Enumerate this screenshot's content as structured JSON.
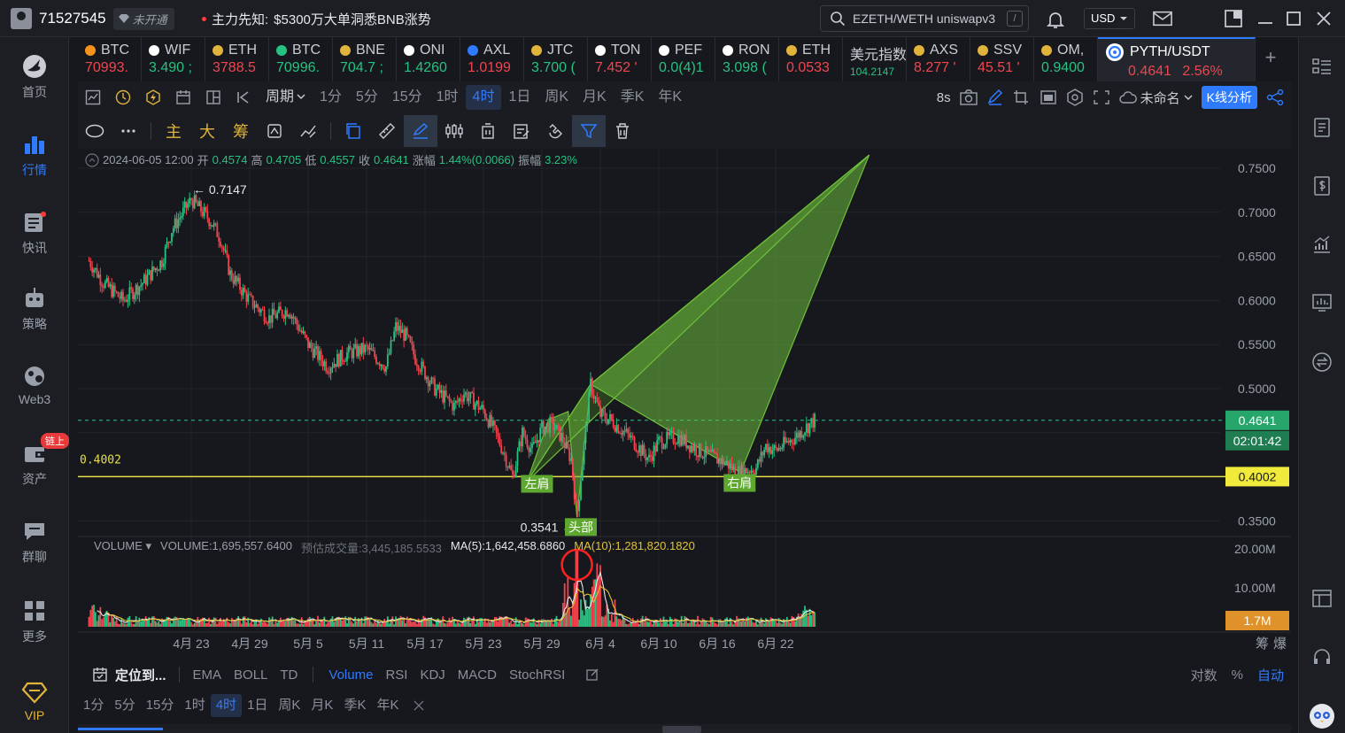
{
  "topbar": {
    "user_id": "71527545",
    "vip_status": "未开通",
    "news_label": "主力先知:",
    "news_text": "$5300万大单洞悉BNB涨势",
    "search_value": "EZETH/WETH uniswapv3",
    "search_shortcut": "/",
    "currency": "USD"
  },
  "leftnav": [
    {
      "label": "首页",
      "icon": "home-icon"
    },
    {
      "label": "行情",
      "icon": "bar-chart-icon"
    },
    {
      "label": "快讯",
      "icon": "news-icon"
    },
    {
      "label": "策略",
      "icon": "robot-icon"
    },
    {
      "label": "Web3",
      "icon": "web3-icon"
    },
    {
      "label": "资产",
      "icon": "wallet-icon",
      "badge": "链上"
    },
    {
      "label": "群聊",
      "icon": "chat-icon"
    },
    {
      "label": "更多",
      "icon": "grid-icon"
    },
    {
      "label": "VIP",
      "icon": "diamond-icon"
    }
  ],
  "tickers": [
    {
      "name": "BTC",
      "price": "70993.",
      "color": "#f7931a",
      "dir": "down"
    },
    {
      "name": "WIF",
      "price": "3.490 ;",
      "color": "#ffffff",
      "dir": "up"
    },
    {
      "name": "ETH",
      "price": "3788.5",
      "color": "#e0b33a",
      "dir": "down"
    },
    {
      "name": "BTC",
      "price": "70996.",
      "color": "#26c281",
      "dir": "up"
    },
    {
      "name": "BNE",
      "price": "704.7 ;",
      "color": "#e0b33a",
      "dir": "up"
    },
    {
      "name": "ONI",
      "price": "1.4260",
      "color": "#ffffff",
      "dir": "up"
    },
    {
      "name": "AXL",
      "price": "1.0199",
      "color": "#2f7bff",
      "dir": "down"
    },
    {
      "name": "JTC",
      "price": "3.700 (",
      "color": "#e0b33a",
      "dir": "up"
    },
    {
      "name": "TON",
      "price": "7.452 '",
      "color": "#ffffff",
      "dir": "down"
    },
    {
      "name": "PEF",
      "price": "0.0(4)1",
      "color": "#ffffff",
      "dir": "up"
    },
    {
      "name": "RON",
      "price": "3.098 (",
      "color": "#ffffff",
      "dir": "up"
    },
    {
      "name": "ETH",
      "price": "0.0533",
      "color": "#e0b33a",
      "dir": "down"
    },
    {
      "name": "美元指数",
      "price": "104.2147",
      "color": "",
      "dir": "up"
    },
    {
      "name": "AXS",
      "price": "8.277 '",
      "color": "#e0b33a",
      "dir": "down"
    },
    {
      "name": "SSV",
      "price": "45.51 '",
      "color": "#e0b33a",
      "dir": "down"
    },
    {
      "name": "OM,",
      "price": "0.9400",
      "color": "#e0b33a",
      "dir": "up"
    }
  ],
  "active_ticker": {
    "name": "PYTH/USDT",
    "price": "0.4641",
    "change": "2.56%"
  },
  "intervals": [
    "周期",
    "1分",
    "5分",
    "15分",
    "1时",
    "4时",
    "1日",
    "周K",
    "月K",
    "季K",
    "年K"
  ],
  "active_interval": "4时",
  "toolbar_right": {
    "refresh": "8s",
    "layout_name": "未命名",
    "analysis_button": "K线分析"
  },
  "drawbar": [
    "主",
    "大",
    "筹"
  ],
  "ohlc": {
    "date": "2024-06-05 12:00",
    "open_label": "开",
    "open": "0.4574",
    "high_label": "高",
    "high": "0.4705",
    "low_label": "低",
    "low": "0.4557",
    "close_label": "收",
    "close": "0.4641",
    "change_label": "涨幅",
    "change": "1.44%(0.0066)",
    "amplitude_label": "振幅",
    "amplitude": "3.23%"
  },
  "chart_data": {
    "type": "candlestick",
    "y_axis": [
      "0.7500",
      "0.7000",
      "0.6500",
      "0.6000",
      "0.5500",
      "0.5000",
      "0.3500"
    ],
    "ylim": [
      0.335,
      0.765
    ],
    "x_axis": [
      "4月 23",
      "4月 29",
      "5月 5",
      "5月 11",
      "5月 17",
      "5月 23",
      "5月 29",
      "6月 4",
      "6月 10",
      "6月 16",
      "6月 22"
    ],
    "x_range_days": [
      0,
      63
    ],
    "price_path": [
      [
        -0.5,
        0.645
      ],
      [
        1,
        0.62
      ],
      [
        3,
        0.6
      ],
      [
        5,
        0.62
      ],
      [
        7,
        0.645
      ],
      [
        8,
        0.68
      ],
      [
        10,
        0.7147
      ],
      [
        12,
        0.69
      ],
      [
        13,
        0.67
      ],
      [
        14,
        0.63
      ],
      [
        16,
        0.6
      ],
      [
        18,
        0.58
      ],
      [
        20,
        0.59
      ],
      [
        21,
        0.57
      ],
      [
        22,
        0.55
      ],
      [
        24,
        0.525
      ],
      [
        26,
        0.54
      ],
      [
        28,
        0.545
      ],
      [
        30,
        0.525
      ],
      [
        31,
        0.57
      ],
      [
        32,
        0.56
      ],
      [
        33,
        0.535
      ],
      [
        35,
        0.5
      ],
      [
        37,
        0.48
      ],
      [
        38,
        0.495
      ],
      [
        40,
        0.475
      ],
      [
        41,
        0.455
      ],
      [
        42,
        0.43
      ],
      [
        43,
        0.4
      ],
      [
        44,
        0.45
      ],
      [
        45,
        0.43
      ],
      [
        46,
        0.455
      ],
      [
        47,
        0.46
      ],
      [
        48,
        0.445
      ],
      [
        49,
        0.42
      ],
      [
        49.6,
        0.3541
      ],
      [
        50,
        0.4
      ],
      [
        51,
        0.505
      ],
      [
        52,
        0.47
      ],
      [
        53,
        0.465
      ],
      [
        55,
        0.445
      ],
      [
        57,
        0.42
      ],
      [
        58,
        0.44
      ],
      [
        60,
        0.445
      ],
      [
        62,
        0.43
      ],
      [
        63,
        0.425
      ],
      [
        65,
        0.415
      ],
      [
        66,
        0.405
      ],
      [
        68,
        0.41
      ],
      [
        69,
        0.435
      ],
      [
        70,
        0.43
      ],
      [
        72,
        0.445
      ],
      [
        73,
        0.455
      ],
      [
        74,
        0.4641
      ]
    ],
    "high_label": "← 0.7147",
    "low_label": "0.3541 →",
    "support_line": {
      "value": 0.4002,
      "label": "0.4002"
    },
    "current_price": "0.4641",
    "countdown": "02:01:42",
    "pattern_labels": [
      "左肩",
      "头部",
      "右肩"
    ],
    "volume": {
      "label": "VOLUME",
      "value_label": "VOLUME:1,695,557.6400",
      "estimate_label": "预估成交量:3,445,185.5533",
      "ma5_label": "MA(5):1,642,458.6860",
      "ma10_label": "MA(10):1,281,820.1820",
      "y_axis": [
        "20.00M",
        "10.00M"
      ],
      "current": "1.7M"
    }
  },
  "indicators": [
    "EMA",
    "BOLL",
    "TD",
    "Volume",
    "RSI",
    "KDJ",
    "MACD",
    "StochRSI"
  ],
  "active_indicator": "Volume",
  "locate_label": "定位到...",
  "indicator_right": [
    "对数",
    "%",
    "自动"
  ],
  "bottom_intervals": [
    "1分",
    "5分",
    "15分",
    "1时",
    "4时",
    "1日",
    "周K",
    "月K",
    "季K",
    "年K"
  ],
  "bottom_active": "4时",
  "colors": {
    "up": "#26c281",
    "down": "#f0454f",
    "accent": "#2f7bff",
    "support": "#e6df4a",
    "pattern": "#6fbf3a"
  }
}
